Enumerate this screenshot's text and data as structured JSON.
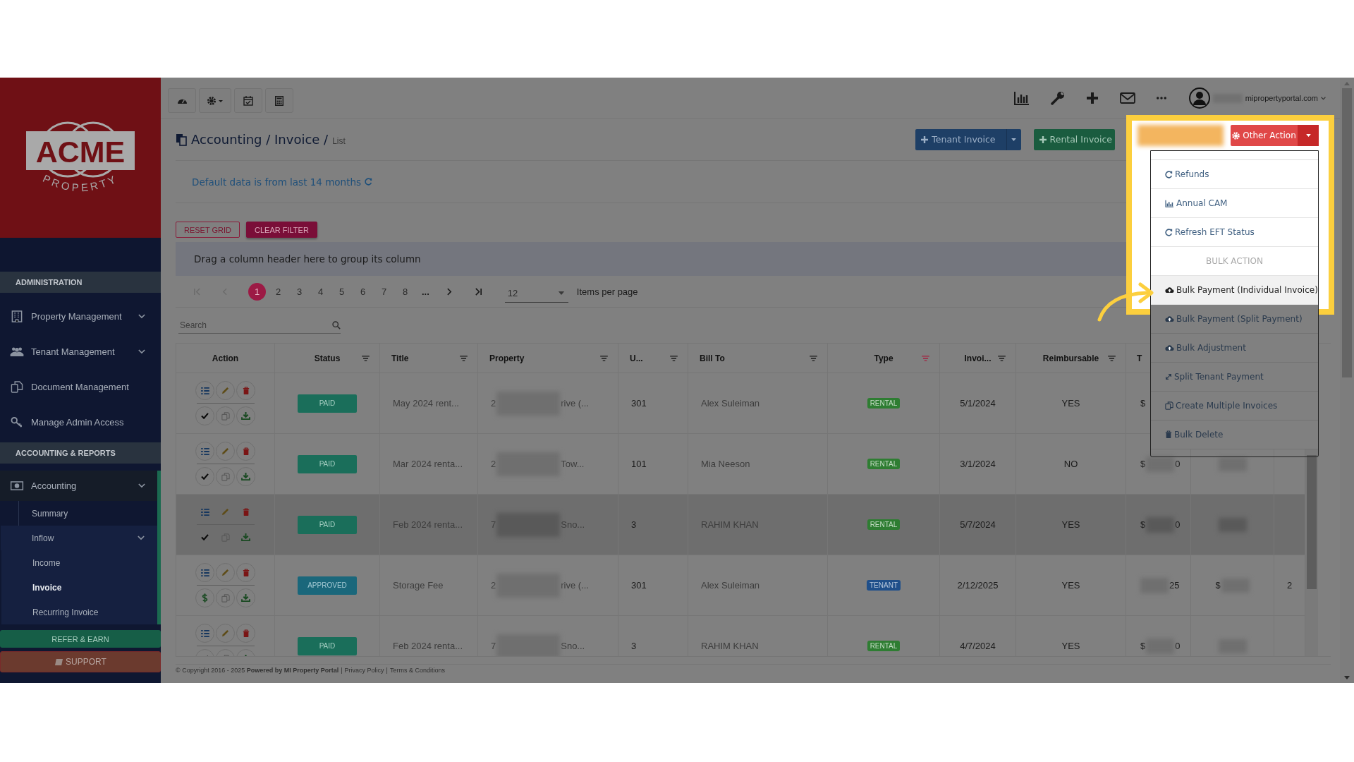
{
  "sidebar": {
    "logo": {
      "wordmark": "ACME",
      "tagline": "PROPERTY"
    },
    "sections": [
      {
        "heading": "ADMINISTRATION",
        "items": [
          {
            "label": "Property Management",
            "expandable": true,
            "selected": false
          },
          {
            "label": "Tenant Management",
            "expandable": true,
            "selected": false
          },
          {
            "label": "Document Management",
            "expandable": false,
            "selected": false
          },
          {
            "label": "Manage Admin Access",
            "expandable": false,
            "selected": false
          }
        ]
      },
      {
        "heading": "ACCOUNTING & REPORTS",
        "items": [
          {
            "label": "Accounting",
            "expandable": true,
            "selected": true,
            "children": [
              {
                "label": "Summary",
                "expandable": false,
                "selected": false
              },
              {
                "label": "Inflow",
                "expandable": true,
                "selected": false,
                "children": [
                  {
                    "label": "Income",
                    "selected": false
                  },
                  {
                    "label": "Invoice",
                    "selected": true
                  },
                  {
                    "label": "Recurring Invoice",
                    "selected": false
                  }
                ]
              }
            ]
          }
        ]
      }
    ],
    "refer_button": "REFER & EARN",
    "support_button": "SUPPORT"
  },
  "topbar": {
    "domain": "mipropertyportal.com"
  },
  "header": {
    "breadcrumb": "Accounting / Invoice /",
    "current": "List",
    "buttons": [
      {
        "label": "Tenant Invoice",
        "kind": "tenant"
      },
      {
        "label": "Rental Invoice",
        "kind": "rental"
      }
    ]
  },
  "notice": "Default data is from last 14 months",
  "grid_buttons": [
    "RESET GRID",
    "CLEAR FILTER"
  ],
  "group_hint": "Drag a column header here to group its column",
  "pager": {
    "pages": [
      {
        "label": "1",
        "selected": true
      },
      {
        "label": "2",
        "selected": false
      },
      {
        "label": "3",
        "selected": false
      },
      {
        "label": "4",
        "selected": false
      },
      {
        "label": "5",
        "selected": false
      },
      {
        "label": "6",
        "selected": false
      },
      {
        "label": "7",
        "selected": false
      },
      {
        "label": "8",
        "selected": false
      }
    ],
    "more": "...",
    "page_size": "12",
    "page_size_label": "Items per page"
  },
  "search": {
    "placeholder": "Search"
  },
  "table": {
    "columns": [
      {
        "label": "Action"
      },
      {
        "label": "Status",
        "filter": true,
        "filtered": false
      },
      {
        "label": "Title",
        "filter": true,
        "filtered": false
      },
      {
        "label": "Property",
        "filter": true,
        "filtered": false
      },
      {
        "label": "U...",
        "filter": true,
        "filtered": false
      },
      {
        "label": "Bill To",
        "filter": true,
        "filtered": false
      },
      {
        "label": "Type",
        "filter": true,
        "filtered": true
      },
      {
        "label": "Invoi...",
        "filter": true,
        "filtered": false
      },
      {
        "label": "Reimbursable",
        "filter": true,
        "filtered": false
      },
      {
        "label": "T"
      }
    ],
    "rows": [
      {
        "highlighted": false,
        "status": {
          "label": "PAID",
          "kind": "paid"
        },
        "title": "May 2024 rent...",
        "property": {
          "start": "2",
          "blurred": true,
          "end": "rive (..."
        },
        "unit": "301",
        "bill_to": "Alex Suleiman",
        "type": {
          "label": "RENTAL",
          "kind": "rental"
        },
        "invoice_date": "5/1/2024",
        "reimbursable": "YES",
        "column_10": {
          "start": "$",
          "blurred": false
        }
      },
      {
        "highlighted": false,
        "status": {
          "label": "PAID",
          "kind": "paid"
        },
        "title": "Mar 2024 renta...",
        "property": {
          "start": "2",
          "blurred": true,
          "end": "Tow..."
        },
        "unit": "101",
        "bill_to": "Mia Neeson",
        "type": {
          "label": "RENTAL",
          "kind": "rental"
        },
        "invoice_date": "3/1/2024",
        "reimbursable": "NO",
        "column_10": {
          "start": "$",
          "blurred": true,
          "end": "0"
        },
        "column_11": {
          "blurred": true
        }
      },
      {
        "highlighted": true,
        "status": {
          "label": "PAID",
          "kind": "paid"
        },
        "title": "Feb 2024 renta...",
        "property": {
          "start": "7",
          "blurred": true,
          "end": "Sno..."
        },
        "unit": "3",
        "bill_to": "RAHIM KHAN",
        "type": {
          "label": "RENTAL",
          "kind": "rental"
        },
        "invoice_date": "5/7/2024",
        "reimbursable": "YES",
        "column_10": {
          "start": "$",
          "blurred": true,
          "end": "0"
        },
        "column_11": {
          "blurred": true
        }
      },
      {
        "highlighted": false,
        "status": {
          "label": "APPROVED",
          "kind": "approved"
        },
        "title": "Storage Fee",
        "property": {
          "start": "2",
          "blurred": true,
          "end": "rive (..."
        },
        "unit": "301",
        "bill_to": "Alex Suleiman",
        "type": {
          "label": "TENANT",
          "kind": "tenant"
        },
        "invoice_date": "2/12/2025",
        "reimbursable": "YES",
        "column_10": {
          "blurred": true,
          "end": "25"
        },
        "column_11": {
          "start": "$",
          "blurred": true
        },
        "column_12": {
          "start": "2",
          "blurred": false
        }
      },
      {
        "highlighted": false,
        "status": {
          "label": "PAID",
          "kind": "paid"
        },
        "title": "Feb 2024 renta...",
        "property": {
          "start": "7",
          "blurred": true,
          "end": "Sno..."
        },
        "unit": "3",
        "bill_to": "RAHIM KHAN",
        "type": {
          "label": "RENTAL",
          "kind": "rental"
        },
        "invoice_date": "4/7/2024",
        "reimbursable": "YES",
        "column_10": {
          "start": "$",
          "blurred": true,
          "end": "0"
        },
        "column_11": {
          "blurred": true
        }
      }
    ]
  },
  "footer": {
    "copyright": "© Copyright 2016 - 2025 **Powered by MI Property Portal**",
    "links": [
      {
        "separator": "|",
        "label": "Privacy Policy"
      },
      {
        "separator": "|",
        "label": "Terms & Conditions"
      }
    ]
  },
  "other_action": {
    "label": "Other Action",
    "menu": [
      {
        "kind": "item",
        "label": "Refunds",
        "spotlit": true,
        "hovered": false
      },
      {
        "kind": "item",
        "label": "Annual CAM",
        "spotlit": true,
        "hovered": false
      },
      {
        "kind": "item",
        "label": "Refresh EFT Status",
        "spotlit": true,
        "hovered": false
      },
      {
        "kind": "heading",
        "label": "BULK ACTION",
        "spotlit": true,
        "hovered": false
      },
      {
        "kind": "item",
        "label": "Bulk Payment (Individual Invoice)",
        "spotlit": true,
        "hovered": true
      },
      {
        "kind": "item",
        "label": "Bulk Payment (Split Payment)",
        "spotlit": false,
        "hovered": false
      },
      {
        "kind": "item",
        "label": "Bulk Adjustment",
        "spotlit": false,
        "hovered": false
      },
      {
        "kind": "item",
        "label": "Split Tenant Payment",
        "spotlit": false,
        "hovered": false
      },
      {
        "kind": "item",
        "label": "Create Multiple Invoices",
        "spotlit": false,
        "hovered": false
      },
      {
        "kind": "item",
        "label": "Bulk Delete",
        "spotlit": false,
        "hovered": false
      }
    ]
  }
}
